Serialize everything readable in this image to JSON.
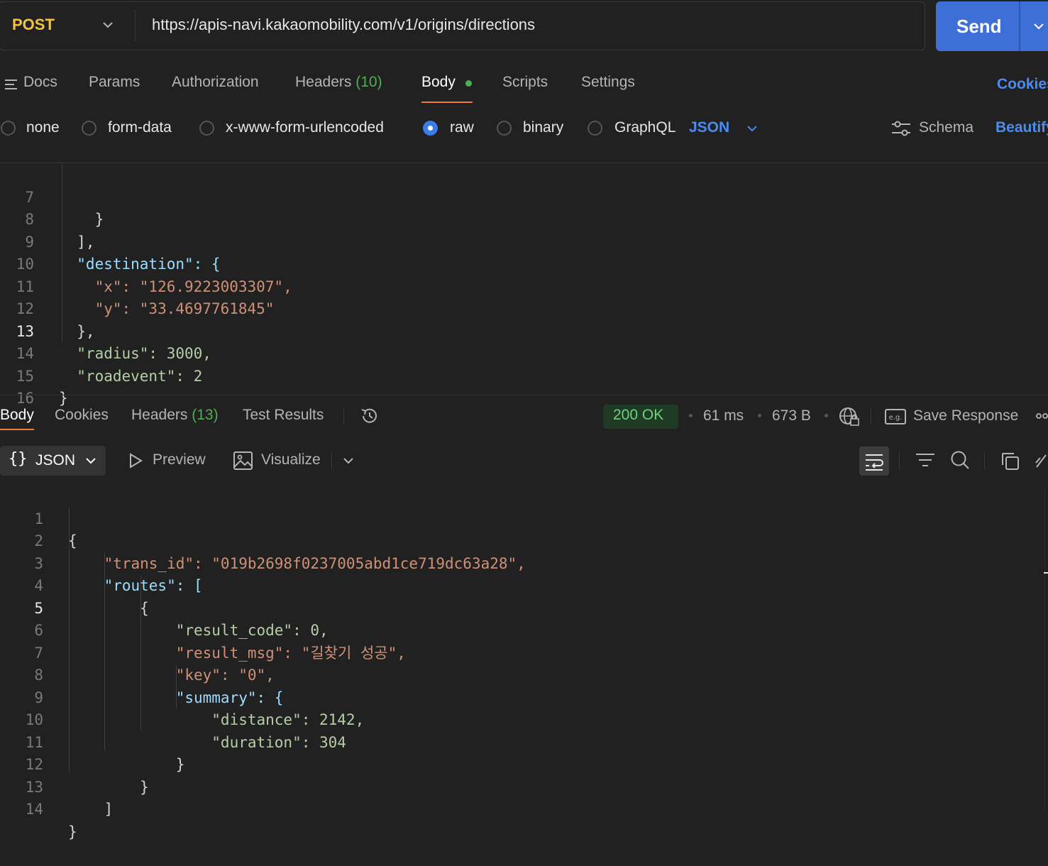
{
  "request": {
    "method": "POST",
    "url": "https://apis-navi.kakaomobility.com/v1/origins/directions",
    "send_label": "Send"
  },
  "request_tabs": {
    "docs": "Docs",
    "params": "Params",
    "authorization": "Authorization",
    "headers": "Headers",
    "headers_count": "(10)",
    "body": "Body",
    "scripts": "Scripts",
    "settings": "Settings",
    "cookies": "Cookies"
  },
  "body_types": {
    "none": "none",
    "form_data": "form-data",
    "urlencoded": "x-www-form-urlencoded",
    "raw": "raw",
    "binary": "binary",
    "graphql": "GraphQL",
    "format": "JSON",
    "selected": "raw",
    "schema": "Schema",
    "beautify": "Beautify"
  },
  "request_body_lines": [
    {
      "n": "7",
      "text": "    }"
    },
    {
      "n": "8",
      "text": "  ],"
    },
    {
      "n": "9",
      "text": "  \"destination\": {"
    },
    {
      "n": "10",
      "text": "    \"x\": \"126.9223003307\","
    },
    {
      "n": "11",
      "text": "    \"y\": \"33.4697761845\""
    },
    {
      "n": "12",
      "text": "  },"
    },
    {
      "n": "13",
      "text": "  \"radius\": 3000,"
    },
    {
      "n": "14",
      "text": "  \"roadevent\": 2"
    },
    {
      "n": "15",
      "text": "}"
    },
    {
      "n": "16",
      "text": ""
    }
  ],
  "response_tabs": {
    "body": "Body",
    "cookies": "Cookies",
    "headers": "Headers",
    "headers_count": "(13)",
    "test_results": "Test Results"
  },
  "response_meta": {
    "status": "200 OK",
    "time": "61 ms",
    "size": "673 B",
    "save_response": "Save Response"
  },
  "response_toolbar": {
    "format": "JSON",
    "preview": "Preview",
    "visualize": "Visualize"
  },
  "response_body_lines": [
    {
      "n": "1",
      "text": "{"
    },
    {
      "n": "2",
      "text": "    \"trans_id\": \"019b2698f0237005abd1ce719dc63a28\","
    },
    {
      "n": "3",
      "text": "    \"routes\": ["
    },
    {
      "n": "4",
      "text": "        {"
    },
    {
      "n": "5",
      "text": "            \"result_code\": 0,"
    },
    {
      "n": "6",
      "text": "            \"result_msg\": \"길찾기 성공\","
    },
    {
      "n": "7",
      "text": "            \"key\": \"0\","
    },
    {
      "n": "8",
      "text": "            \"summary\": {"
    },
    {
      "n": "9",
      "text": "                \"distance\": 2142,"
    },
    {
      "n": "10",
      "text": "                \"duration\": 304"
    },
    {
      "n": "11",
      "text": "            }"
    },
    {
      "n": "12",
      "text": "        }"
    },
    {
      "n": "13",
      "text": "    ]"
    },
    {
      "n": "14",
      "text": "}"
    }
  ],
  "colors": {
    "method": "#f5c242",
    "accent": "#3d6fd6",
    "tab_underline": "#f07c3c",
    "status_ok": "#6ed17a",
    "json_key": "#9cdcfe",
    "json_string": "#ce9178",
    "json_number": "#b5cea8"
  }
}
